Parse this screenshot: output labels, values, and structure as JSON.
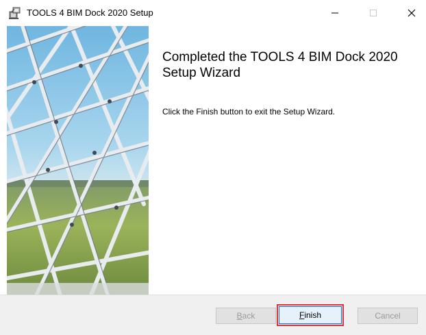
{
  "window": {
    "title": "TOOLS 4 BIM Dock 2020 Setup",
    "controls": {
      "minimize": "—",
      "maximize": "☐",
      "close": "✕"
    }
  },
  "content": {
    "heading": "Completed the TOOLS 4 BIM Dock 2020 Setup Wizard",
    "body": "Click the Finish button to exit the Setup Wizard."
  },
  "buttons": {
    "back": {
      "accel": "B",
      "rest": "ack",
      "enabled": false
    },
    "finish": {
      "accel": "F",
      "rest": "inish",
      "enabled": true,
      "highlighted": true
    },
    "cancel": {
      "label": "Cancel",
      "enabled": false
    }
  },
  "colors": {
    "highlight_box": "#e0303a",
    "finish_border": "#0078d7",
    "disabled_text": "#9a9a9a",
    "footer_bg": "#f0f0f0"
  },
  "side_image": {
    "subject": "glass dome steel lattice over landscape"
  }
}
